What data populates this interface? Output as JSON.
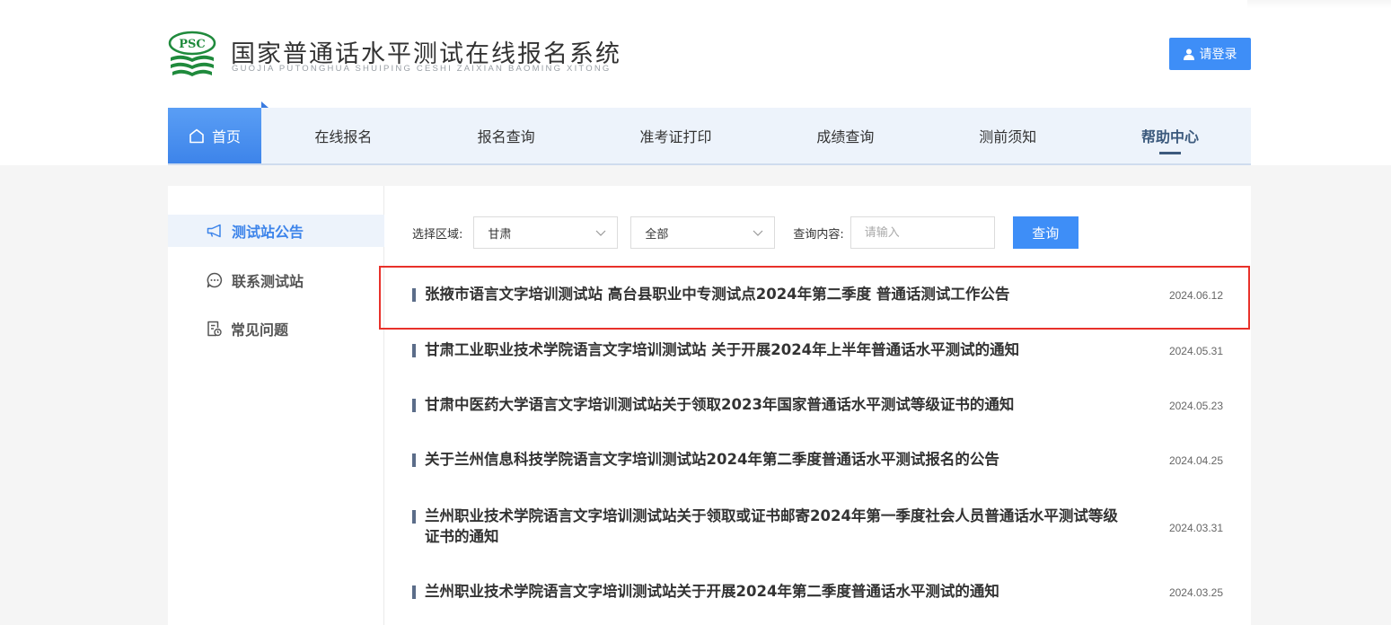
{
  "header": {
    "title": "国家普通话水平测试在线报名系统",
    "subtitle": "GUOJIA PUTONGHUA SHUIPING CESHI ZAIXIAN BAOMING XITONG",
    "logo_text": "PSC",
    "login_label": "请登录"
  },
  "nav": [
    {
      "label": "首页"
    },
    {
      "label": "在线报名"
    },
    {
      "label": "报名查询"
    },
    {
      "label": "准考证打印"
    },
    {
      "label": "成绩查询"
    },
    {
      "label": "测前须知"
    },
    {
      "label": "帮助中心"
    }
  ],
  "sidebar": [
    {
      "label": "测试站公告"
    },
    {
      "label": "联系测试站"
    },
    {
      "label": "常见问题"
    }
  ],
  "filters": {
    "region_label": "选择区域:",
    "region_value": "甘肃",
    "scope_value": "全部",
    "query_label": "查询内容:",
    "query_placeholder": "请输入",
    "search_label": "查询"
  },
  "news": [
    {
      "title": "张掖市语言文字培训测试站 高台县职业中专测试点2024年第二季度 普通话测试工作公告",
      "date": "2024.06.12"
    },
    {
      "title": "甘肃工业职业技术学院语言文字培训测试站 关于开展2024年上半年普通话水平测试的通知",
      "date": "2024.05.31"
    },
    {
      "title": "甘肃中医药大学语言文字培训测试站关于领取2023年国家普通话水平测试等级证书的通知",
      "date": "2024.05.23"
    },
    {
      "title": "关于兰州信息科技学院语言文字培训测试站2024年第二季度普通话水平测试报名的公告",
      "date": "2024.04.25"
    },
    {
      "title": "兰州职业技术学院语言文字培训测试站关于领取或证书邮寄2024年第一季度社会人员普通话水平测试等级证书的通知",
      "date": "2024.03.31"
    },
    {
      "title": "兰州职业技术学院语言文字培训测试站关于开展2024年第二季度普通话水平测试的通知",
      "date": "2024.03.25"
    }
  ],
  "colors": {
    "accent": "#3e8ef7",
    "highlight": "#e8312a",
    "logo_green": "#1f8a3c"
  }
}
